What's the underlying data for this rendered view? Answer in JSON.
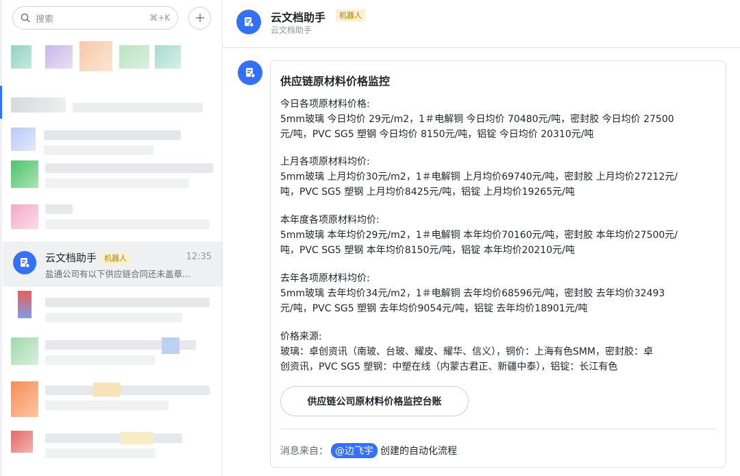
{
  "search": {
    "placeholder": "搜索",
    "shortcut": "⌘+K"
  },
  "active_conversation": {
    "name": "云文档助手",
    "tag": "机器人",
    "time": "12:35",
    "preview": "盐通公司有以下供应链合同还未盖章..."
  },
  "header": {
    "title": "云文档助手",
    "tag": "机器人",
    "subtitle": "云文档助手"
  },
  "card": {
    "title": "供应链原材料价格监控",
    "sections": [
      {
        "heading": "今日各项原材料价格:",
        "lines": [
          "5mm玻璃 今日均价 29元/m2，1＃电解铜 今日均价 70480元/吨，密封胶 今日均价 27500",
          "元/吨，PVC SG5 塑钢 今日均价 8150元/吨，铝锭 今日均价 20310元/吨"
        ]
      },
      {
        "heading": "上月各项原材料均价:",
        "lines": [
          "5mm玻璃 上月均价30元/m2，1＃电解铜 上月均价69740元/吨，密封胶 上月均价27212元/",
          "吨，PVC SG5 塑钢 上月均价8425元/吨，铝锭 上月均价19265元/吨"
        ]
      },
      {
        "heading": "本年度各项原材料均价:",
        "lines": [
          "5mm玻璃 本年均价29元/m2，1＃电解铜 本年均价70160元/吨，密封胶 本年均价27500元/",
          "吨，PVC SG5 塑钢 本年均价8150元/吨，铝锭 本年均价20210元/吨"
        ]
      },
      {
        "heading": "去年各项原材料均价:",
        "lines": [
          "5mm玻璃 去年均价34元/m2，1＃电解铜 去年均价68596元/吨，密封胶 去年均价32493",
          "元/吨，PVC SG5 塑钢 去年均价9054元/吨，铝锭 去年均价18901元/吨"
        ]
      },
      {
        "heading": "价格来源:",
        "lines": [
          "玻璃：卓创资讯（南玻、台玻、耀皮、耀华、信义），铜价：上海有色SMM，密封胶：卓",
          "创资讯，PVC SG5 塑钢：中塑在线（内蒙古君正、新疆中泰），铝锭：长江有色"
        ]
      }
    ],
    "button_label": "供应链公司原材料价格监控台账",
    "footer": {
      "label": "消息来自：",
      "mention": "@边飞宇",
      "suffix": "创建的自动化流程"
    }
  },
  "colors": {
    "accent": "#3370ff",
    "tag_bg": "#faf1d1",
    "tag_text": "#b27e00"
  },
  "icons": [
    "search-icon",
    "plus-icon",
    "doc-bot-icon"
  ]
}
